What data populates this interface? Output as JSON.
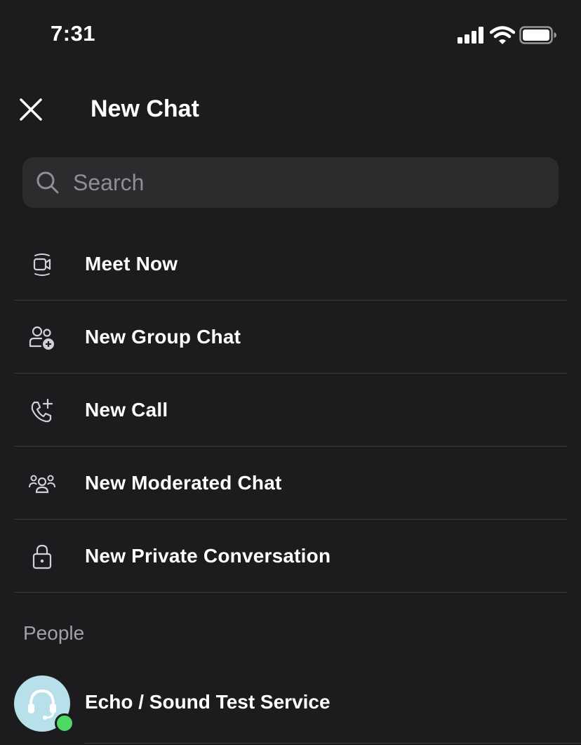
{
  "status_bar": {
    "time": "7:31"
  },
  "header": {
    "title": "New Chat",
    "close_icon": "close-icon"
  },
  "search": {
    "placeholder": "Search",
    "value": ""
  },
  "actions": [
    {
      "label": "Meet Now",
      "icon": "video-camera-icon"
    },
    {
      "label": "New Group Chat",
      "icon": "add-group-icon"
    },
    {
      "label": "New Call",
      "icon": "add-call-icon"
    },
    {
      "label": "New Moderated Chat",
      "icon": "moderated-group-icon"
    },
    {
      "label": "New Private Conversation",
      "icon": "lock-icon"
    }
  ],
  "people": {
    "section_label": "People",
    "items": [
      {
        "name": "Echo / Sound Test Service",
        "status": "online",
        "status_color": "#4cd964"
      }
    ]
  },
  "colors": {
    "background": "#1c1c1e",
    "search_background": "#2c2c2e",
    "divider": "#3a3a3c",
    "secondary_text": "#a1a1a6"
  }
}
